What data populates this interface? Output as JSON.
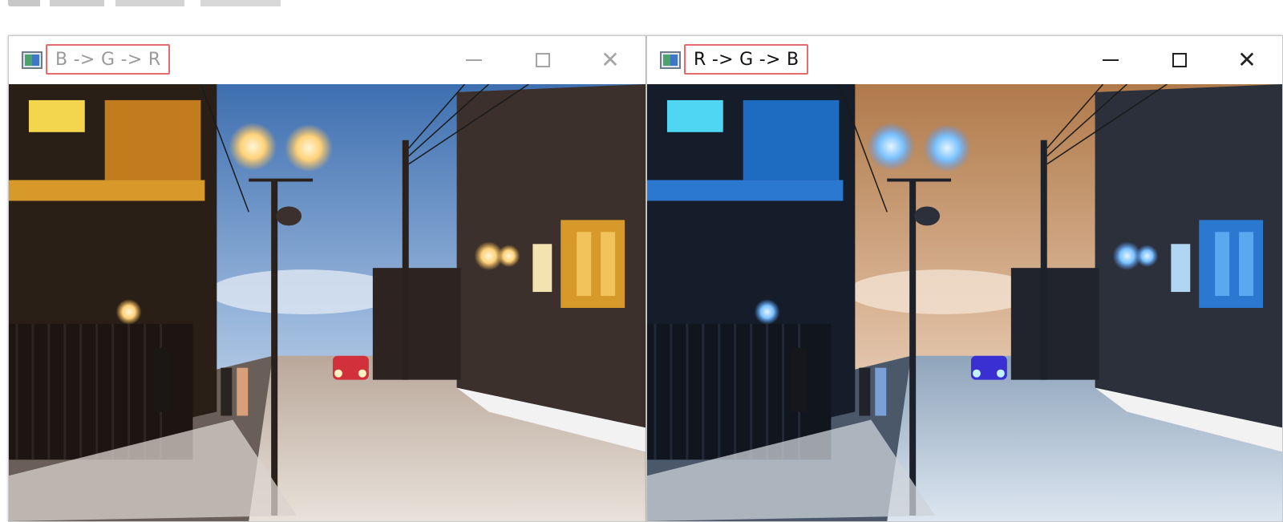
{
  "windows": [
    {
      "id": "bgr",
      "title": "B -> G -> R",
      "icon": "app-window-icon",
      "controls": {
        "minimize": "minimize-icon",
        "maximize": "maximize-icon",
        "close": "close-icon"
      },
      "image": {
        "content": "street-photo",
        "channel_order": "BGR"
      }
    },
    {
      "id": "rgb",
      "title": "R -> G -> B",
      "icon": "app-window-icon",
      "controls": {
        "minimize": "minimize-icon",
        "maximize": "maximize-icon",
        "close": "close-icon"
      },
      "image": {
        "content": "street-photo",
        "channel_order": "RGB"
      }
    }
  ],
  "colors": {
    "highlight_border": "#e46c6c",
    "inactive_title": "#9a9a9a",
    "active_title": "#111111"
  }
}
